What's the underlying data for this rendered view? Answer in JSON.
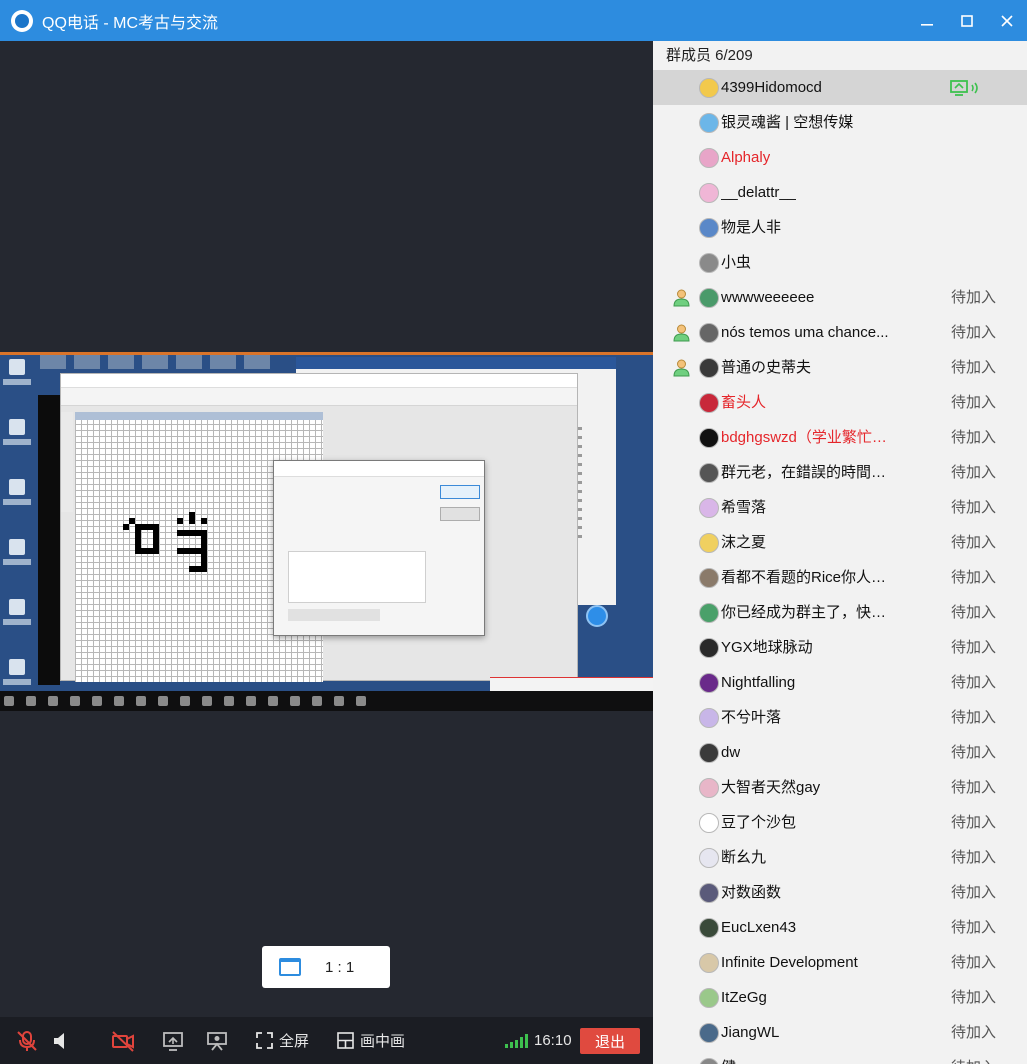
{
  "window": {
    "title": "QQ电话 - MC考古与交流",
    "controls": [
      "minimize-icon",
      "maximize-icon",
      "close-icon"
    ]
  },
  "video": {
    "ratio_label": "1 : 1"
  },
  "controls_bar": {
    "fullscreen_label": "全屏",
    "pip_label": "画中画",
    "time": "16:10",
    "exit_label": "退出",
    "colors": {
      "exit": "#e04a3f",
      "signal": "#3ec14f",
      "muted": "#e0443c"
    }
  },
  "members_panel": {
    "header": "群成员 6/209",
    "members": [
      {
        "name": "4399Hidomocd",
        "status": "",
        "avatar_color": "#f2c94c",
        "sharing": true,
        "active": true
      },
      {
        "name": "银灵魂酱 | 空想传媒",
        "status": "",
        "avatar_color": "#6cb6e8"
      },
      {
        "name": "Alphaly",
        "status": "",
        "avatar_color": "#e8a5c8",
        "red": true
      },
      {
        "name": "__delattr__",
        "status": "",
        "avatar_color": "#f0b6d6"
      },
      {
        "name": "物是人非",
        "status": "",
        "avatar_color": "#5a88c8"
      },
      {
        "name": "小虫",
        "status": "",
        "avatar_color": "#8a8a8a"
      },
      {
        "name": "wwwweeeeee",
        "status": "待加入",
        "avatar_color": "#4a9a6a",
        "person": true
      },
      {
        "name": "nós temos uma chance...",
        "status": "待加入",
        "avatar_color": "#666666",
        "person": true
      },
      {
        "name": "普通の史蒂夫",
        "status": "待加入",
        "avatar_color": "#3a3a3a",
        "person": true
      },
      {
        "name": "畜头人",
        "status": "待加入",
        "avatar_color": "#c8283a",
        "red": true
      },
      {
        "name": "bdghgswzd（学业繁忙）...",
        "status": "待加入",
        "avatar_color": "#111111",
        "red": true
      },
      {
        "name": "群元老，在錯誤的時間發...",
        "status": "待加入",
        "avatar_color": "#555555"
      },
      {
        "name": "希雪落",
        "status": "待加入",
        "avatar_color": "#d9b6e8"
      },
      {
        "name": "沫之夏",
        "status": "待加入",
        "avatar_color": "#f0d060"
      },
      {
        "name": "看都不看题的Rice你人呢...",
        "status": "待加入",
        "avatar_color": "#8a7a6a"
      },
      {
        "name": "你已经成为群主了，快与...",
        "status": "待加入",
        "avatar_color": "#4aa06a"
      },
      {
        "name": "YGX地球脉动",
        "status": "待加入",
        "avatar_color": "#2a2a2a"
      },
      {
        "name": "Nightfalling",
        "status": "待加入",
        "avatar_color": "#6a2a8a"
      },
      {
        "name": "不兮叶落",
        "status": "待加入",
        "avatar_color": "#c8b6e8"
      },
      {
        "name": "dw",
        "status": "待加入",
        "avatar_color": "#3a3a3a"
      },
      {
        "name": "大智者天然gay",
        "status": "待加入",
        "avatar_color": "#e8b6c8"
      },
      {
        "name": "豆了个沙包",
        "status": "待加入",
        "avatar_color": "#ffffff"
      },
      {
        "name": "断幺九",
        "status": "待加入",
        "avatar_color": "#e6e6f0"
      },
      {
        "name": "对数函数",
        "status": "待加入",
        "avatar_color": "#5a5a7a"
      },
      {
        "name": "EucLxen43",
        "status": "待加入",
        "avatar_color": "#3a4a3a"
      },
      {
        "name": "Infinite Development",
        "status": "待加入",
        "avatar_color": "#d8c8a8"
      },
      {
        "name": "ItZeGg",
        "status": "待加入",
        "avatar_color": "#9ac88a"
      },
      {
        "name": "JiangWL",
        "status": "待加入",
        "avatar_color": "#4a6a8a"
      },
      {
        "name": "健",
        "status": "待加入",
        "avatar_color": "#888888"
      }
    ]
  }
}
